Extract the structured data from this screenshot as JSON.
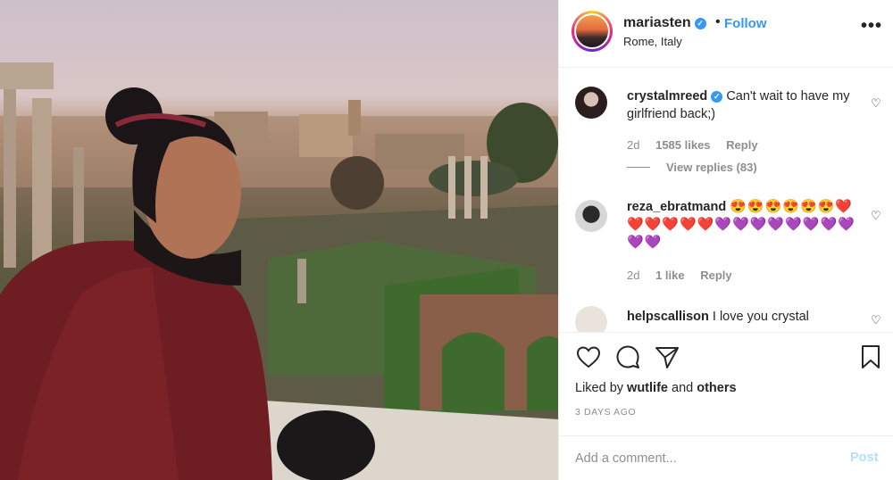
{
  "post": {
    "username": "mariasten",
    "verified_icon": "verified-badge-icon",
    "separator": "•",
    "follow_label": "Follow",
    "location": "Rome, Italy",
    "more_label": "•••"
  },
  "comments": [
    {
      "username": "crystalmreed",
      "verified": true,
      "text": "Can't wait to have my girlfriend back;)",
      "age": "2d",
      "likes": "1585 likes",
      "reply_label": "Reply",
      "view_replies": "View replies (83)"
    },
    {
      "username": "reza_ebratmand",
      "verified": false,
      "text": "😍😍😍😍😍😍❤️❤️❤️❤️❤️❤️💜💜💜💜💜💜💜💜💜💜",
      "age": "2d",
      "likes": "1 like",
      "reply_label": "Reply"
    },
    {
      "username": "helpscallison",
      "verified": false,
      "text": "I love you crystal"
    }
  ],
  "actions": {
    "liked_prefix": "Liked by",
    "liked_user": "wutlife",
    "liked_and": "and",
    "liked_others": "others",
    "timestamp": "3 DAYS AGO"
  },
  "composer": {
    "placeholder": "Add a comment...",
    "post_label": "Post"
  },
  "colors": {
    "accent": "#3897f0",
    "post_disabled": "#b2dffc",
    "muted": "#8e8e8e",
    "text": "#262626"
  }
}
